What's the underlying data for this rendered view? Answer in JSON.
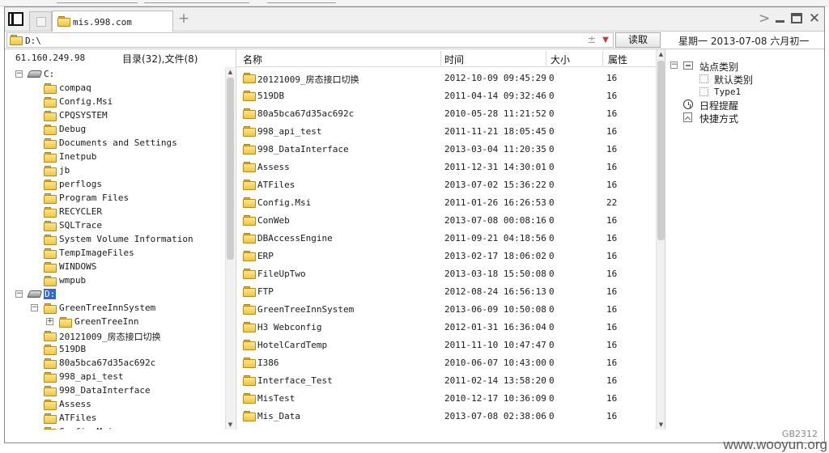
{
  "tabbar": {
    "active_tab": "mis.998.com",
    "add_label": "+",
    "forward_label": ">",
    "close_label": "✕"
  },
  "address": {
    "path": "D:\\",
    "plus_label": "±",
    "dropdown_label": "▼",
    "read_button": "读取",
    "date_text": "星期一  2013-07-08  六月初一"
  },
  "left": {
    "ip": "61.160.249.98",
    "dir_count": "目录(32),文件(8)",
    "tree": [
      {
        "label": "C:",
        "kind": "drive",
        "indent": 0,
        "expander": "⊟"
      },
      {
        "label": "compaq",
        "indent": 1
      },
      {
        "label": "Config.Msi",
        "indent": 1
      },
      {
        "label": "CPQSYSTEM",
        "indent": 1
      },
      {
        "label": "Debug",
        "indent": 1
      },
      {
        "label": "Documents and Settings",
        "indent": 1
      },
      {
        "label": "Inetpub",
        "indent": 1
      },
      {
        "label": "jb",
        "indent": 1
      },
      {
        "label": "perflogs",
        "indent": 1
      },
      {
        "label": "Program Files",
        "indent": 1
      },
      {
        "label": "RECYCLER",
        "indent": 1
      },
      {
        "label": "SQLTrace",
        "indent": 1
      },
      {
        "label": "System Volume Information",
        "indent": 1
      },
      {
        "label": "TempImageFiles",
        "indent": 1
      },
      {
        "label": "WINDOWS",
        "indent": 1
      },
      {
        "label": "wmpub",
        "indent": 1
      },
      {
        "label": "D:",
        "kind": "drive",
        "indent": 0,
        "expander": "⊟",
        "selected": true
      },
      {
        "label": "GreenTreeInnSystem",
        "indent": 1,
        "expander": "⊟"
      },
      {
        "label": "GreenTreeInn",
        "indent": 2,
        "expander": "⊞"
      },
      {
        "label": "20121009_房态接口切换",
        "indent": 1
      },
      {
        "label": "519DB",
        "indent": 1
      },
      {
        "label": "80a5bca67d35ac692c",
        "indent": 1
      },
      {
        "label": "998_api_test",
        "indent": 1
      },
      {
        "label": "998_DataInterface",
        "indent": 1
      },
      {
        "label": "Assess",
        "indent": 1
      },
      {
        "label": "ATFiles",
        "indent": 1
      },
      {
        "label": "Config.Msi",
        "indent": 1
      }
    ]
  },
  "table": {
    "headers": {
      "name": "名称",
      "time": "时间",
      "size": "大小",
      "attr": "属性"
    },
    "rows": [
      {
        "name": "20121009_房态接口切换",
        "time": "2012-10-09 09:45:29",
        "size": "0",
        "attr": "16"
      },
      {
        "name": "519DB",
        "time": "2011-04-14 09:32:46",
        "size": "0",
        "attr": "16"
      },
      {
        "name": "80a5bca67d35ac692c",
        "time": "2010-05-28 11:21:52",
        "size": "0",
        "attr": "16"
      },
      {
        "name": "998_api_test",
        "time": "2011-11-21 18:05:45",
        "size": "0",
        "attr": "16"
      },
      {
        "name": "998_DataInterface",
        "time": "2013-03-04 11:20:35",
        "size": "0",
        "attr": "16"
      },
      {
        "name": "Assess",
        "time": "2011-12-31 14:30:01",
        "size": "0",
        "attr": "16"
      },
      {
        "name": "ATFiles",
        "time": "2013-07-02 15:36:22",
        "size": "0",
        "attr": "16"
      },
      {
        "name": "Config.Msi",
        "time": "2011-01-26 16:26:53",
        "size": "0",
        "attr": "22"
      },
      {
        "name": "ConWeb",
        "time": "2013-07-08 00:08:16",
        "size": "0",
        "attr": "16"
      },
      {
        "name": "DBAccessEngine",
        "time": "2011-09-21 04:18:56",
        "size": "0",
        "attr": "16"
      },
      {
        "name": "ERP",
        "time": "2013-02-17 18:06:02",
        "size": "0",
        "attr": "16"
      },
      {
        "name": "FileUpTwo",
        "time": "2013-03-18 15:50:08",
        "size": "0",
        "attr": "16"
      },
      {
        "name": "FTP",
        "time": "2012-08-24 16:56:13",
        "size": "0",
        "attr": "16"
      },
      {
        "name": "GreenTreeInnSystem",
        "time": "2013-06-09 10:50:08",
        "size": "0",
        "attr": "16"
      },
      {
        "name": "H3 Webconfig",
        "time": "2012-01-31 16:36:04",
        "size": "0",
        "attr": "16"
      },
      {
        "name": "HotelCardTemp",
        "time": "2011-11-10 10:47:47",
        "size": "0",
        "attr": "16"
      },
      {
        "name": "I386",
        "time": "2010-06-07 10:43:00",
        "size": "0",
        "attr": "16"
      },
      {
        "name": "Interface_Test",
        "time": "2011-02-14 13:58:20",
        "size": "0",
        "attr": "16"
      },
      {
        "name": "MisTest",
        "time": "2010-12-17 10:36:09",
        "size": "0",
        "attr": "16"
      },
      {
        "name": "Mis_Data",
        "time": "2013-07-08 02:38:06",
        "size": "0",
        "attr": "16"
      }
    ]
  },
  "right": {
    "category_root": "站点类别",
    "default_category": "默认类别",
    "type1": "Type1",
    "schedule": "日程提醒",
    "shortcuts": "快捷方式"
  },
  "footer": {
    "encoding": "GB2312",
    "watermark": "www.wooyun.org"
  },
  "colors": {
    "selection": "#3169c6",
    "folder": "#f5d46a"
  }
}
